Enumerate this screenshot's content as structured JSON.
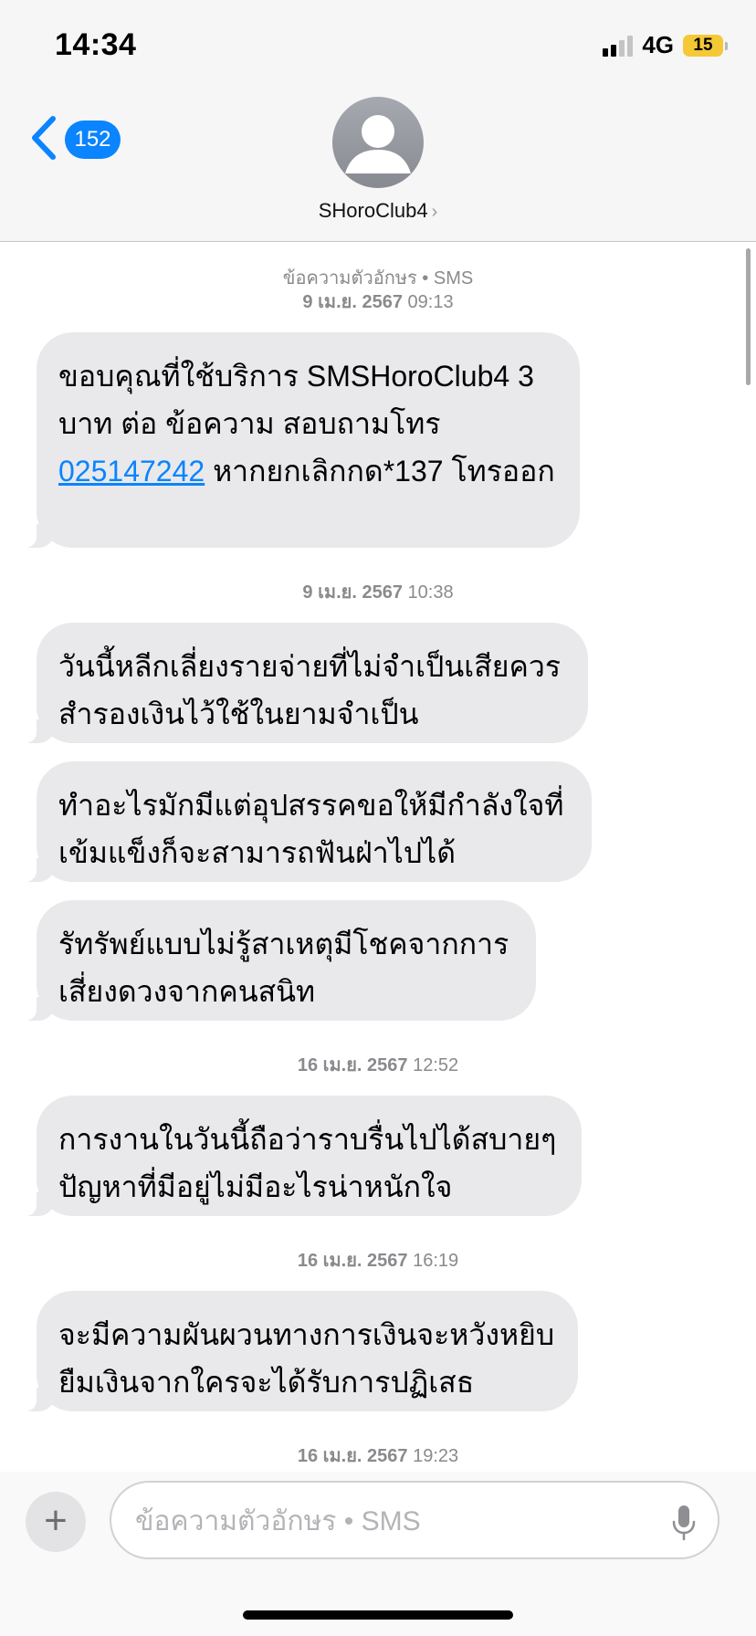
{
  "status_bar": {
    "time": "14:34",
    "network": "4G",
    "battery": "15"
  },
  "header": {
    "back_count": "152",
    "contact_name": "SHoroClub4",
    "contact_chevron": "›"
  },
  "thread": {
    "service_label": "ข้อความตัวอักษร • SMS",
    "groups": [
      {
        "timestamp_date": "9 เม.ย. 2567",
        "timestamp_time": "09:13",
        "messages": [
          {
            "text_1": "ขอบคุณที่ใช้บริการ SMSHoroClub4 3 บาท ต่อ ข้อความ สอบถามโทร ",
            "link": "025147242",
            "text_2": " หากยกเลิกกด*137 โทรออก"
          }
        ]
      },
      {
        "timestamp_date": "9 เม.ย. 2567",
        "timestamp_time": "10:38",
        "messages": [
          {
            "text": "วันนี้หลีกเลี่ยงรายจ่ายที่ไม่จำเป็นเสียควรสำรองเงินไว้ใช้ในยามจำเป็น"
          },
          {
            "text": "ทำอะไรมักมีแต่อุปสรรคขอให้มีกำลังใจที่เข้มแข็งก็จะสามารถฟันฝ่าไปได้"
          },
          {
            "text": "รัทรัพย์แบบไม่รู้สาเหตุมีโชคจากการเสี่ยงดวงจากคนสนิท"
          }
        ]
      },
      {
        "timestamp_date": "16 เม.ย. 2567",
        "timestamp_time": "12:52",
        "messages": [
          {
            "text": "การงานในวันนี้ถือว่าราบรื่นไปได้สบายๆปัญหาที่มีอยู่ไม่มีอะไรน่าหนักใจ"
          }
        ]
      },
      {
        "timestamp_date": "16 เม.ย. 2567",
        "timestamp_time": "16:19",
        "messages": [
          {
            "text": "จะมีความผันผวนทางการเงินจะหวังหยิบยืมเงินจากใครจะได้รับการปฏิเสธ"
          }
        ]
      },
      {
        "timestamp_date": "16 เม.ย. 2567",
        "timestamp_time": "19:23",
        "messages": []
      }
    ]
  },
  "composer": {
    "plus_label": "+",
    "placeholder": "ข้อความตัวอักษร • SMS",
    "value": ""
  },
  "colors": {
    "accent": "#0a84ff",
    "bubble_incoming": "#e9e9eb",
    "battery": "#f5c935"
  },
  "icons": [
    "back-chevron-icon",
    "contact-avatar-icon",
    "plus-icon",
    "microphone-icon",
    "signal-icon",
    "battery-icon"
  ]
}
